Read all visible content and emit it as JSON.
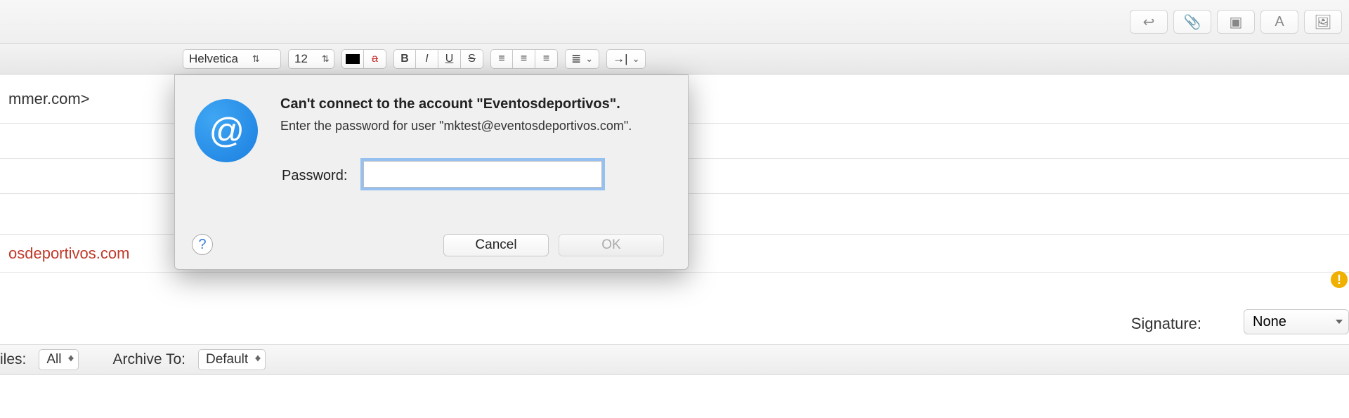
{
  "toolbar": {
    "reply_icon": "↩",
    "attach_icon": "📎",
    "photo_icon": "▣",
    "format_icon": "A",
    "media_icon": "🖼"
  },
  "format": {
    "font": "Helvetica",
    "size": "12",
    "a_color_label": "a",
    "bold": "B",
    "italic": "I",
    "underline": "U",
    "strike": "S",
    "align_left": "≡",
    "align_center": "≡",
    "align_right": "≡",
    "list": "≣",
    "indent": "→|"
  },
  "rows": {
    "from_fragment": "mmer.com>",
    "account_fragment": "osdeportivos.com"
  },
  "signature": {
    "label": "Signature:",
    "value": "None"
  },
  "rules": {
    "label_fragment": "iles:",
    "all": "All",
    "archive_label": "Archive To:",
    "archive_value": "Default"
  },
  "dialog": {
    "at": "@",
    "title": "Can't connect to the account \"Eventosdeportivos\".",
    "subtitle": "Enter the password for user \"mktest@eventosdeportivos.com\".",
    "password_label": "Password:",
    "cancel": "Cancel",
    "ok": "OK",
    "help": "?"
  },
  "badge": {
    "excl": "!"
  }
}
